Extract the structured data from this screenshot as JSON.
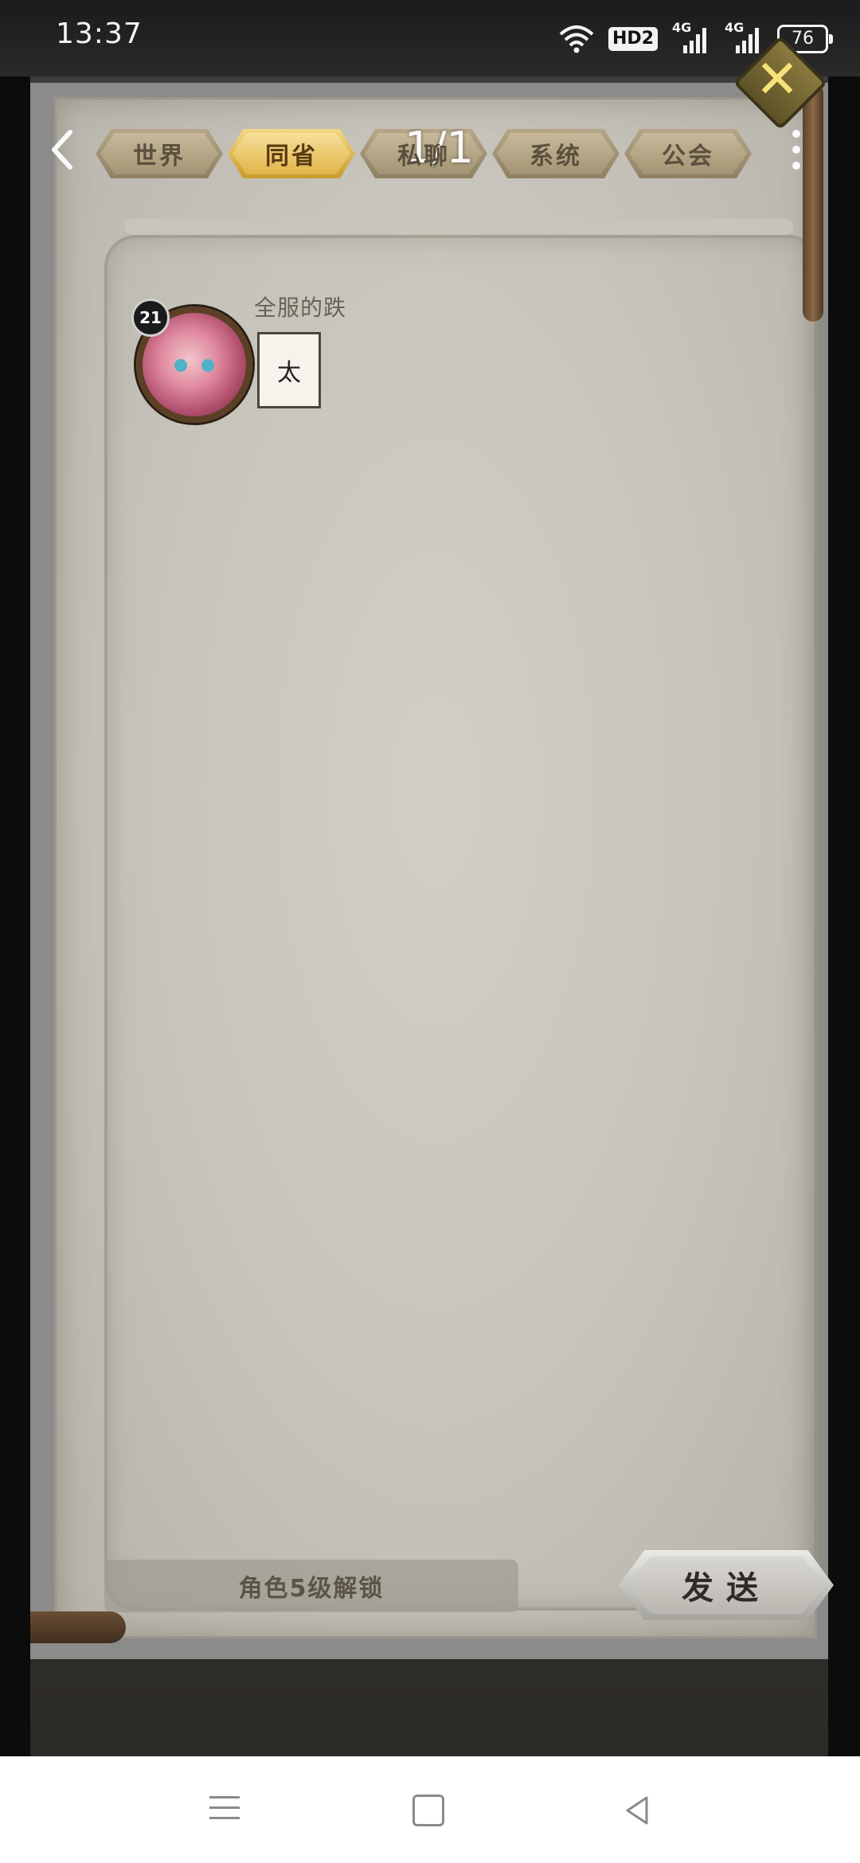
{
  "status_bar": {
    "time": "13:37",
    "hd_label": "HD2",
    "network1": "4G",
    "network2": "4G",
    "battery": "76"
  },
  "header": {
    "page_counter": "1/1",
    "tabs": [
      {
        "label": "世界",
        "active": false
      },
      {
        "label": "同省",
        "active": true
      },
      {
        "label": "私聊",
        "active": false
      },
      {
        "label": "系统",
        "active": false
      },
      {
        "label": "公会",
        "active": false
      }
    ]
  },
  "messages": [
    {
      "username": "全服的跌",
      "level": "21",
      "text": "太"
    }
  ],
  "input": {
    "placeholder": "角色5级解锁",
    "send_label": "发送"
  },
  "icons": {
    "back": "chevron-left-icon",
    "more": "more-vertical-icon",
    "close": "close-icon"
  },
  "colors": {
    "active_tab": "#e0b448",
    "inactive_tab": "#a39474",
    "page": "#c9c6be"
  }
}
